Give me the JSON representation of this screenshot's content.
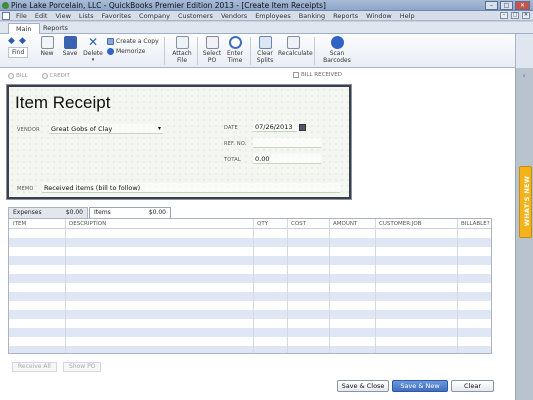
{
  "window": {
    "title": "Pine Lake Porcelain, LLC  - QuickBooks Premier Edition 2013 - [Create Item Receipts]",
    "controls": [
      "–",
      "□",
      "✕"
    ]
  },
  "menu": [
    "File",
    "Edit",
    "View",
    "Lists",
    "Favorites",
    "Company",
    "Customers",
    "Vendors",
    "Employees",
    "Banking",
    "Reports",
    "Window",
    "Help"
  ],
  "mdi_controls": [
    "–",
    "□",
    "✕"
  ],
  "tabs": [
    {
      "label": "Main"
    },
    {
      "label": "Reports"
    }
  ],
  "ribbon": {
    "find": "Find",
    "new": "New",
    "save": "Save",
    "delete": "Delete",
    "create_copy": "Create a Copy",
    "memorize": "Memorize",
    "attach_file": [
      "Attach",
      "File"
    ],
    "select_po": [
      "Select",
      "PO"
    ],
    "enter_time": [
      "Enter",
      "Time"
    ],
    "clear_splits": [
      "Clear",
      "Splits"
    ],
    "recalculate": "Recalculate",
    "scan_barcodes": [
      "Scan",
      "Barcodes"
    ]
  },
  "radios": {
    "bill": "BILL",
    "credit": "CREDIT"
  },
  "bill_received": "BILL RECEIVED",
  "form": {
    "header": "Item Receipt",
    "vendor_label": "VENDOR",
    "vendor_value": "Great Gobs of Clay",
    "date_label": "DATE",
    "date_value": "07/26/2013",
    "ref_label": "REF. NO.",
    "ref_value": "",
    "total_label": "TOTAL",
    "total_value": "0.00",
    "memo_label": "MEMO",
    "memo_value": "Received items (bill to follow)"
  },
  "subtabs": [
    {
      "label": "Expenses",
      "amount": "$0.00"
    },
    {
      "label": "Items",
      "amount": "$0.00"
    }
  ],
  "grid_columns": [
    "ITEM",
    "DESCRIPTION",
    "QTY",
    "COST",
    "AMOUNT",
    "CUSTOMER:JOB",
    "BILLABLE?"
  ],
  "bottom_buttons": {
    "receive_all": "Receive All",
    "show_po": "Show PO"
  },
  "actions": {
    "save_close": "Save & Close",
    "save_new": "Save & New",
    "clear": "Clear"
  },
  "side_panel": {
    "whats_new": "WHAT'S NEW",
    "collapse": "‹"
  },
  "colors": {
    "accent": "#3e6fc0",
    "whats_new": "#f3b41b",
    "row_alt": "#dfe7f4"
  }
}
